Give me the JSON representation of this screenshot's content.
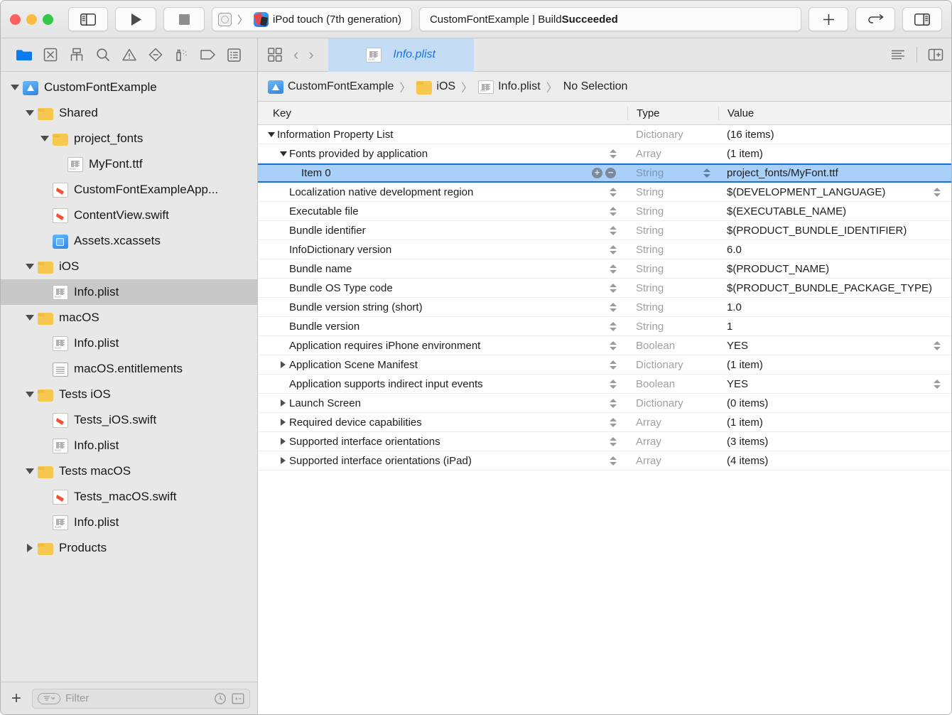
{
  "window": {
    "traffic_lights": [
      "close",
      "minimize",
      "zoom"
    ],
    "colors": {
      "red": "#fc615d",
      "yellow": "#fdbc40",
      "green": "#34c749",
      "accent": "#1a74e2",
      "selection": "#a8d0f8"
    }
  },
  "toolbar": {
    "sidebar_toggle": "toggle-navigator",
    "run_label": "Run",
    "stop_label": "Stop",
    "scheme": {
      "target": "",
      "destination": "iPod touch (7th generation)",
      "separator": "〉"
    },
    "status": {
      "prefix": "CustomFontExample | Build ",
      "result": "Succeeded"
    },
    "add_label": "+",
    "code_review_label": "⇄",
    "inspector_toggle": "toggle-inspector"
  },
  "navigator": {
    "tools": [
      {
        "name": "project-navigator-icon",
        "title": "Project"
      },
      {
        "name": "source-control-navigator-icon",
        "title": "Source Control"
      },
      {
        "name": "symbol-navigator-icon",
        "title": "Symbols"
      },
      {
        "name": "find-navigator-icon",
        "title": "Find"
      },
      {
        "name": "issue-navigator-icon",
        "title": "Issues"
      },
      {
        "name": "test-navigator-icon",
        "title": "Tests"
      },
      {
        "name": "debug-navigator-icon",
        "title": "Debug"
      },
      {
        "name": "breakpoint-navigator-icon",
        "title": "Breakpoints"
      },
      {
        "name": "report-navigator-icon",
        "title": "Reports"
      }
    ],
    "tree": [
      {
        "label": "CustomFontExample",
        "indent": 0,
        "disclosure": "down",
        "icon": "xcproj",
        "selected": false
      },
      {
        "label": "Shared",
        "indent": 1,
        "disclosure": "down",
        "icon": "folder",
        "selected": false
      },
      {
        "label": "project_fonts",
        "indent": 2,
        "disclosure": "down",
        "icon": "folder",
        "selected": false
      },
      {
        "label": "MyFont.ttf",
        "indent": 3,
        "disclosure": "none",
        "icon": "plist",
        "selected": false
      },
      {
        "label": "CustomFontExampleApp...",
        "indent": 2,
        "disclosure": "none",
        "icon": "swift",
        "selected": false
      },
      {
        "label": "ContentView.swift",
        "indent": 2,
        "disclosure": "none",
        "icon": "swift",
        "selected": false
      },
      {
        "label": "Assets.xcassets",
        "indent": 2,
        "disclosure": "none",
        "icon": "assets",
        "selected": false
      },
      {
        "label": "iOS",
        "indent": 1,
        "disclosure": "down",
        "icon": "folder",
        "selected": false
      },
      {
        "label": "Info.plist",
        "indent": 2,
        "disclosure": "none",
        "icon": "plist",
        "selected": true
      },
      {
        "label": "macOS",
        "indent": 1,
        "disclosure": "down",
        "icon": "folder",
        "selected": false
      },
      {
        "label": "Info.plist",
        "indent": 2,
        "disclosure": "none",
        "icon": "plist",
        "selected": false
      },
      {
        "label": "macOS.entitlements",
        "indent": 2,
        "disclosure": "none",
        "icon": "entl",
        "selected": false
      },
      {
        "label": "Tests iOS",
        "indent": 1,
        "disclosure": "down",
        "icon": "folder",
        "selected": false
      },
      {
        "label": "Tests_iOS.swift",
        "indent": 2,
        "disclosure": "none",
        "icon": "swift",
        "selected": false
      },
      {
        "label": "Info.plist",
        "indent": 2,
        "disclosure": "none",
        "icon": "plist",
        "selected": false
      },
      {
        "label": "Tests macOS",
        "indent": 1,
        "disclosure": "down",
        "icon": "folder",
        "selected": false
      },
      {
        "label": "Tests_macOS.swift",
        "indent": 2,
        "disclosure": "none",
        "icon": "swift",
        "selected": false
      },
      {
        "label": "Info.plist",
        "indent": 2,
        "disclosure": "none",
        "icon": "plist",
        "selected": false
      },
      {
        "label": "Products",
        "indent": 1,
        "disclosure": "right",
        "icon": "folder",
        "selected": false
      }
    ],
    "footer": {
      "add_label": "+",
      "filter_placeholder": "Filter",
      "recent_icon": "clock-icon",
      "source_control_icon": "plus-minus-icon"
    }
  },
  "editor": {
    "tab_overview_icon": "tab-overview-icon",
    "back_label": "‹",
    "forward_label": "›",
    "tab": {
      "label": "Info.plist",
      "icon": "plist-file-icon"
    },
    "right_tools": [
      {
        "name": "editor-options-icon"
      },
      {
        "name": "add-editor-icon"
      }
    ],
    "breadcrumb": [
      {
        "label": "CustomFontExample",
        "icon": "xcproj"
      },
      {
        "label": "iOS",
        "icon": "folder"
      },
      {
        "label": "Info.plist",
        "icon": "plist"
      },
      {
        "label": "No Selection",
        "icon": "none"
      }
    ]
  },
  "plist": {
    "columns": {
      "key": "Key",
      "type": "Type",
      "value": "Value"
    },
    "rows": [
      {
        "key": "Information Property List",
        "type": "Dictionary",
        "value": "(16 items)",
        "indent": 0,
        "disclosure": "down",
        "selected": false,
        "key_stepper": false,
        "value_stepper": false,
        "right_stepper": false,
        "plusminus": false
      },
      {
        "key": "Fonts provided by application",
        "type": "Array",
        "value": "(1 item)",
        "indent": 1,
        "disclosure": "down",
        "selected": false,
        "key_stepper": true,
        "value_stepper": false,
        "right_stepper": false,
        "plusminus": false
      },
      {
        "key": "Item 0",
        "type": "String",
        "value": "project_fonts/MyFont.ttf",
        "indent": 2,
        "disclosure": "none",
        "selected": true,
        "key_stepper": false,
        "value_stepper": true,
        "right_stepper": false,
        "plusminus": true
      },
      {
        "key": "Localization native development region",
        "type": "String",
        "value": "$(DEVELOPMENT_LANGUAGE)",
        "indent": 1,
        "disclosure": "none",
        "selected": false,
        "key_stepper": true,
        "value_stepper": false,
        "right_stepper": true,
        "plusminus": false
      },
      {
        "key": "Executable file",
        "type": "String",
        "value": "$(EXECUTABLE_NAME)",
        "indent": 1,
        "disclosure": "none",
        "selected": false,
        "key_stepper": true,
        "value_stepper": false,
        "right_stepper": false,
        "plusminus": false
      },
      {
        "key": "Bundle identifier",
        "type": "String",
        "value": "$(PRODUCT_BUNDLE_IDENTIFIER)",
        "indent": 1,
        "disclosure": "none",
        "selected": false,
        "key_stepper": true,
        "value_stepper": false,
        "right_stepper": false,
        "plusminus": false
      },
      {
        "key": "InfoDictionary version",
        "type": "String",
        "value": "6.0",
        "indent": 1,
        "disclosure": "none",
        "selected": false,
        "key_stepper": true,
        "value_stepper": false,
        "right_stepper": false,
        "plusminus": false
      },
      {
        "key": "Bundle name",
        "type": "String",
        "value": "$(PRODUCT_NAME)",
        "indent": 1,
        "disclosure": "none",
        "selected": false,
        "key_stepper": true,
        "value_stepper": false,
        "right_stepper": false,
        "plusminus": false
      },
      {
        "key": "Bundle OS Type code",
        "type": "String",
        "value": "$(PRODUCT_BUNDLE_PACKAGE_TYPE)",
        "indent": 1,
        "disclosure": "none",
        "selected": false,
        "key_stepper": true,
        "value_stepper": false,
        "right_stepper": false,
        "plusminus": false
      },
      {
        "key": "Bundle version string (short)",
        "type": "String",
        "value": "1.0",
        "indent": 1,
        "disclosure": "none",
        "selected": false,
        "key_stepper": true,
        "value_stepper": false,
        "right_stepper": false,
        "plusminus": false
      },
      {
        "key": "Bundle version",
        "type": "String",
        "value": "1",
        "indent": 1,
        "disclosure": "none",
        "selected": false,
        "key_stepper": true,
        "value_stepper": false,
        "right_stepper": false,
        "plusminus": false
      },
      {
        "key": "Application requires iPhone environment",
        "type": "Boolean",
        "value": "YES",
        "indent": 1,
        "disclosure": "none",
        "selected": false,
        "key_stepper": true,
        "value_stepper": false,
        "right_stepper": true,
        "plusminus": false
      },
      {
        "key": "Application Scene Manifest",
        "type": "Dictionary",
        "value": "(1 item)",
        "indent": 1,
        "disclosure": "right",
        "selected": false,
        "key_stepper": true,
        "value_stepper": false,
        "right_stepper": false,
        "plusminus": false
      },
      {
        "key": "Application supports indirect input events",
        "type": "Boolean",
        "value": "YES",
        "indent": 1,
        "disclosure": "none",
        "selected": false,
        "key_stepper": true,
        "value_stepper": false,
        "right_stepper": true,
        "plusminus": false
      },
      {
        "key": "Launch Screen",
        "type": "Dictionary",
        "value": "(0 items)",
        "indent": 1,
        "disclosure": "right",
        "selected": false,
        "key_stepper": true,
        "value_stepper": false,
        "right_stepper": false,
        "plusminus": false
      },
      {
        "key": "Required device capabilities",
        "type": "Array",
        "value": "(1 item)",
        "indent": 1,
        "disclosure": "right",
        "selected": false,
        "key_stepper": true,
        "value_stepper": false,
        "right_stepper": false,
        "plusminus": false
      },
      {
        "key": "Supported interface orientations",
        "type": "Array",
        "value": "(3 items)",
        "indent": 1,
        "disclosure": "right",
        "selected": false,
        "key_stepper": true,
        "value_stepper": false,
        "right_stepper": false,
        "plusminus": false
      },
      {
        "key": "Supported interface orientations (iPad)",
        "type": "Array",
        "value": "(4 items)",
        "indent": 1,
        "disclosure": "right",
        "selected": false,
        "key_stepper": true,
        "value_stepper": false,
        "right_stepper": false,
        "plusminus": false
      }
    ]
  }
}
